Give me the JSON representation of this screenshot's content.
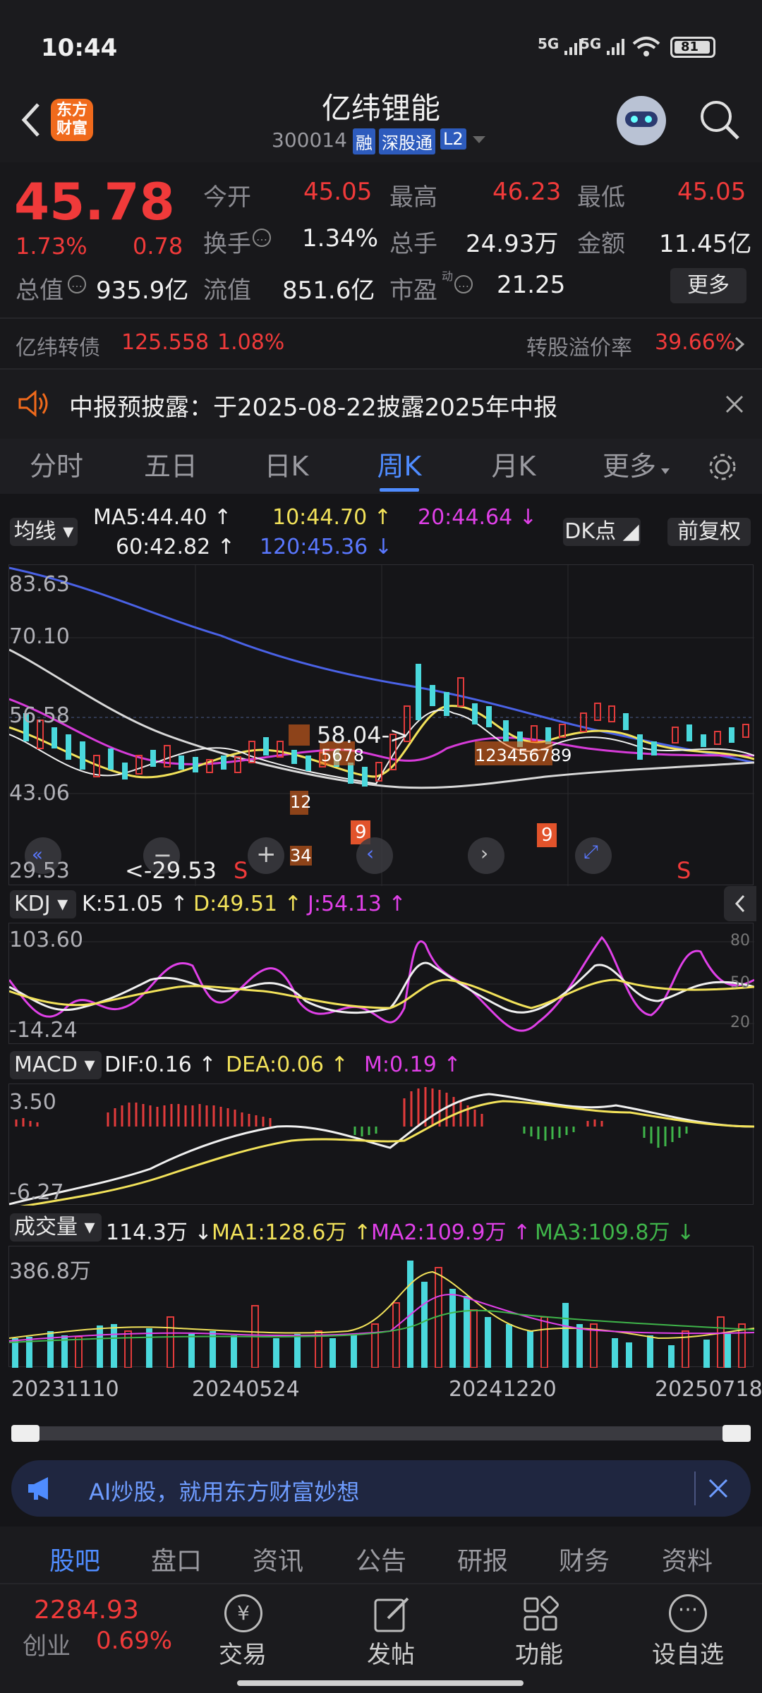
{
  "status_bar": {
    "time": "10:44",
    "network1": "5G",
    "network2": "5G",
    "battery": "81"
  },
  "header": {
    "title": "亿纬锂能",
    "code": "300014",
    "badge1": "融",
    "badge2": "深股通",
    "badge3": "L2",
    "brand": "东方财富"
  },
  "quote": {
    "price": "45.78",
    "change_pct": "1.73%",
    "change": "0.78",
    "open_label": "今开",
    "open": "45.05",
    "high_label": "最高",
    "high": "46.23",
    "low_label": "最低",
    "low": "45.05",
    "turnover_label": "换手",
    "turnover": "1.34%",
    "vol_label": "总手",
    "vol": "24.93万",
    "amount_label": "金额",
    "amount": "11.45亿",
    "mcap_label": "总值",
    "mcap": "935.9亿",
    "float_label": "流值",
    "float": "851.6亿",
    "pe_label": "市盈",
    "pe_sup": "动",
    "pe": "21.25",
    "more": "更多"
  },
  "bond": {
    "name": "亿纬转债",
    "price": "125.558",
    "pct": "1.08%",
    "premium_label": "转股溢价率",
    "premium": "39.66%"
  },
  "notice": {
    "text": "中报预披露：于2025-08-22披露2025年中报"
  },
  "tabs": [
    "分时",
    "五日",
    "日K",
    "周K",
    "月K",
    "更多"
  ],
  "active_tab": "周K",
  "ma": {
    "label": "均线",
    "ma5": "MA5:44.40",
    "ma10": "10:44.70",
    "ma20": "20:44.64",
    "ma60": "60:42.82",
    "ma120": "120:45.36",
    "dk": "DK点",
    "adj": "前复权"
  },
  "chart": {
    "y_labels": [
      "83.63",
      "70.10",
      "56.58",
      "43.06",
      "29.53"
    ],
    "annot_high": "58.04->",
    "annot_low": "<-29.53",
    "s1": "S",
    "s2": "S",
    "nine1": "9",
    "nine2": "9",
    "nums1": "12",
    "nums2": "5678",
    "nums3": "34",
    "nums4": "123456789"
  },
  "kdj": {
    "label": "KDJ",
    "k": "K:51.05",
    "d": "D:49.51",
    "j": "J:54.13",
    "y_top": "103.60",
    "y_bot": "-14.24",
    "r80": "80",
    "r50": "50",
    "r20": "20"
  },
  "macd": {
    "label": "MACD",
    "dif": "DIF:0.16",
    "dea": "DEA:0.06",
    "m": "M:0.19",
    "y_top": "3.50",
    "y_bot": "-6.27"
  },
  "volume": {
    "label": "成交量",
    "value": "114.3万",
    "ma1": "MA1:128.6万",
    "ma2": "MA2:109.9万",
    "ma3": "MA3:109.8万",
    "y_top": "386.8万"
  },
  "dates": [
    "20231110",
    "20240524",
    "20241220",
    "20250718"
  ],
  "ai_banner": {
    "text": "AI炒股，就用东方财富妙想"
  },
  "bottom_tabs": [
    "股吧",
    "盘口",
    "资讯",
    "公告",
    "研报",
    "财务",
    "资料"
  ],
  "bottom_nav": {
    "index_value": "2284.93",
    "index_name": "创业",
    "index_pct": "0.69%",
    "trade": "交易",
    "post": "发帖",
    "func": "功能",
    "watch": "设自选",
    "trade_icon": "¥"
  }
}
